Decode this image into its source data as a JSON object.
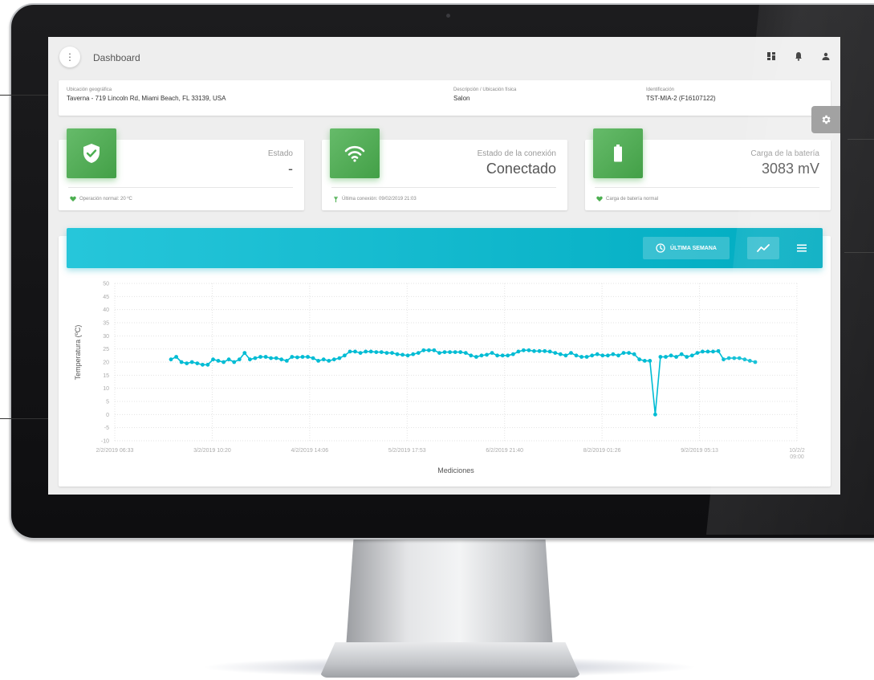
{
  "app": {
    "title": "Dashboard"
  },
  "header_icons": [
    "dashboard-grid-icon",
    "bell-icon",
    "user-icon"
  ],
  "info": {
    "location_label": "Ubicación geográfica",
    "location_value": "Taverna - 719 Lincoln Rd, Miami Beach, FL 33139, USA",
    "description_label": "Descripción / Ubicación física",
    "description_value": "Salon",
    "id_label": "Identificación",
    "id_value": "TST-MIA-2 (F16107122)"
  },
  "stats": [
    {
      "icon": "shield-check-icon",
      "title": "Estado",
      "value": "-",
      "footer": "Operación normal: 20 ºC",
      "footer_icon": "heart-icon"
    },
    {
      "icon": "wifi-icon",
      "title": "Estado de la conexión",
      "value": "Conectado",
      "footer": "Última conexión: 09/02/2019 21:03",
      "footer_icon": "antenna-icon"
    },
    {
      "icon": "battery-icon",
      "title": "Carga de la batería",
      "value": "3083 mV",
      "footer": "Carga de batería normal",
      "footer_icon": "heart-icon"
    }
  ],
  "chart_header": {
    "week_label": "ÚLTIMA SEMANA"
  },
  "colors": {
    "accent": "#00bcd4",
    "success": "#4caf50",
    "line": "#00bcd4"
  },
  "chart_data": {
    "type": "line",
    "title": "",
    "xlabel": "Mediciones",
    "ylabel": "Temperatura (ºC)",
    "ylim": [
      -10,
      50
    ],
    "yticks": [
      50,
      45,
      40,
      35,
      30,
      25,
      20,
      15,
      10,
      5,
      0,
      -5,
      -10
    ],
    "xticks": [
      "2/2/2019 06:33",
      "3/2/2019 10:20",
      "4/2/2019 14:06",
      "5/2/2019 17:53",
      "6/2/2019 21:40",
      "8/2/2019 01:26",
      "9/2/2019 05:13",
      "10/2/2019 09:00"
    ],
    "grid": true,
    "series": [
      {
        "values": [
          21,
          22,
          20,
          19.5,
          20,
          19.5,
          19,
          19,
          21,
          20.5,
          20,
          21,
          20,
          21,
          23.5,
          21,
          21.5,
          22,
          22,
          21.5,
          21.5,
          21,
          20.5,
          22,
          21.8,
          22,
          22,
          21.5,
          20.5,
          21,
          20.5,
          21,
          21.5,
          22.5,
          24,
          24,
          23.5,
          24,
          24,
          23.8,
          23.8,
          23.5,
          23.5,
          23,
          22.8,
          22.5,
          23,
          23.5,
          24.5,
          24.5,
          24.5,
          23.5,
          23.8,
          23.8,
          23.8,
          23.8,
          23.5,
          22.5,
          22,
          22.5,
          22.8,
          23.5,
          22.5,
          22.5,
          22.5,
          23,
          24,
          24.5,
          24.5,
          24.2,
          24.2,
          24.2,
          24,
          23.5,
          23,
          22.5,
          23.5,
          22.5,
          22,
          22,
          22.5,
          23,
          22.5,
          22.5,
          23,
          22.5,
          23.5,
          23.5,
          23,
          21,
          20.5,
          20.5,
          0,
          22,
          22,
          22.5,
          22,
          23,
          22,
          22.5,
          23.5,
          24,
          24,
          24,
          24.2,
          21,
          21.5,
          21.5,
          21.5,
          21,
          20.5,
          20
        ]
      }
    ]
  }
}
